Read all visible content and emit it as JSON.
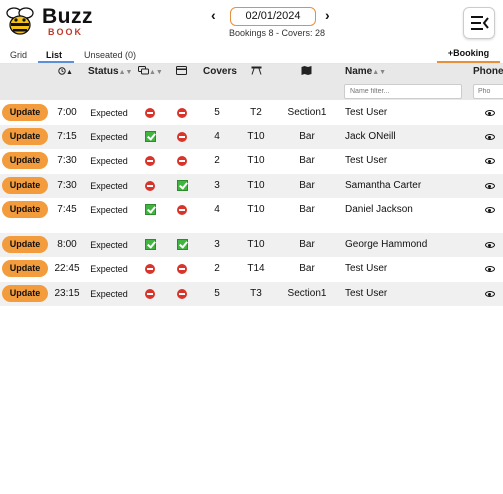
{
  "app": {
    "name": "Buzz",
    "subtitle": "BOOK"
  },
  "date_nav": {
    "prev": "‹",
    "date": "02/01/2024",
    "next": "›"
  },
  "summary": "Bookings 8  -  Covers: 28",
  "tabs": [
    {
      "label": "Grid"
    },
    {
      "label": "List"
    },
    {
      "label": "Unseated (0)"
    }
  ],
  "add_booking_label": "+Booking",
  "table": {
    "headers": {
      "status": "Status",
      "covers": "Covers",
      "name": "Name",
      "phone": "Phone"
    },
    "name_filter_placeholder": "Name filter...",
    "phone_filter_placeholder": "Pho",
    "update_label": "Update",
    "rows": [
      {
        "time": "7:00",
        "status": "Expected",
        "col3": "no",
        "col4": "no",
        "covers": "5",
        "table": "T2",
        "area": "Section1",
        "name": "Test User"
      },
      {
        "time": "7:15",
        "status": "Expected",
        "col3": "yes",
        "col4": "no",
        "covers": "4",
        "table": "T10",
        "area": "Bar",
        "name": "Jack ONeill"
      },
      {
        "time": "7:30",
        "status": "Expected",
        "col3": "no",
        "col4": "no",
        "covers": "2",
        "table": "T10",
        "area": "Bar",
        "name": "Test User"
      },
      {
        "time": "7:30",
        "status": "Expected",
        "col3": "no",
        "col4": "yes",
        "covers": "3",
        "table": "T10",
        "area": "Bar",
        "name": "Samantha Carter"
      },
      {
        "time": "7:45",
        "status": "Expected",
        "col3": "yes",
        "col4": "no",
        "covers": "4",
        "table": "T10",
        "area": "Bar",
        "name": "Daniel Jackson"
      },
      {
        "time": "8:00",
        "status": "Expected",
        "col3": "yes",
        "col4": "yes",
        "covers": "3",
        "table": "T10",
        "area": "Bar",
        "name": "George Hammond"
      },
      {
        "time": "22:45",
        "status": "Expected",
        "col3": "no",
        "col4": "no",
        "covers": "2",
        "table": "T14",
        "area": "Bar",
        "name": "Test User"
      },
      {
        "time": "23:15",
        "status": "Expected",
        "col3": "no",
        "col4": "no",
        "covers": "5",
        "table": "T3",
        "area": "Section1",
        "name": "Test User"
      }
    ]
  },
  "colors": {
    "accent": "#f39c3d",
    "no": "#d9342b",
    "yes": "#3fb53f",
    "tab_underline": "#5b8fd6"
  }
}
